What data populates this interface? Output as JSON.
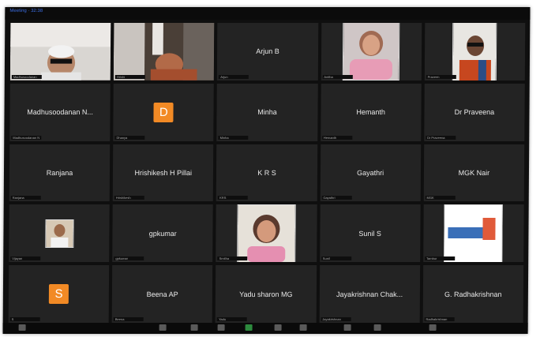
{
  "window": {
    "title": "Meeting · 32:38"
  },
  "participants": [
    {
      "tag": "Madhusoodanan"
    },
    {
      "tag": "Hrishi"
    },
    {
      "name": "Arjun B",
      "tag": "Arjun"
    },
    {
      "tag": "Anitha"
    },
    {
      "tag": "Praveen"
    },
    {
      "name": "Madhusoodanan N...",
      "tag": "Madhusoodanan N"
    },
    {
      "avatar": "D",
      "tag": "Dhanya"
    },
    {
      "name": "Minha",
      "tag": "Minha"
    },
    {
      "name": "Hemanth",
      "tag": "Hemanth"
    },
    {
      "name": "Dr Praveena",
      "tag": "Dr Praveena"
    },
    {
      "name": "Ranjana",
      "tag": "Ranjana"
    },
    {
      "name": "Hrishikesh H Pillai",
      "tag": "Hrishikesh"
    },
    {
      "name": "K R S",
      "tag": "KRS"
    },
    {
      "name": "Gayathri",
      "tag": "Gayathri"
    },
    {
      "name": "MGK Nair",
      "tag": "MGK"
    },
    {
      "tag": "Vijayan"
    },
    {
      "name": "gpkumar",
      "tag": "gpkumar"
    },
    {
      "tag": "Smitha"
    },
    {
      "name": "Sunil S",
      "tag": "Sunil"
    },
    {
      "tag": "Tambur"
    },
    {
      "avatar": "S",
      "tag": "S"
    },
    {
      "name": "Beena AP",
      "tag": "Beena"
    },
    {
      "name": "Yadu sharon MG",
      "tag": "Yadu"
    },
    {
      "name": "Jayakrishnan Chak...",
      "tag": "Jayakrishnan"
    },
    {
      "name": "G. Radhakrishnan",
      "tag": "Radhakrishnan"
    }
  ],
  "colors": {
    "tile": "#232323",
    "avatar": "#f28a25",
    "background": "#0f0f0f"
  },
  "toolbar_icons": [
    "mic-icon",
    "video-icon",
    "security-icon",
    "participants-icon",
    "chat-icon",
    "share-screen-icon",
    "record-icon",
    "reactions-icon",
    "apps-icon",
    "more-icon"
  ]
}
